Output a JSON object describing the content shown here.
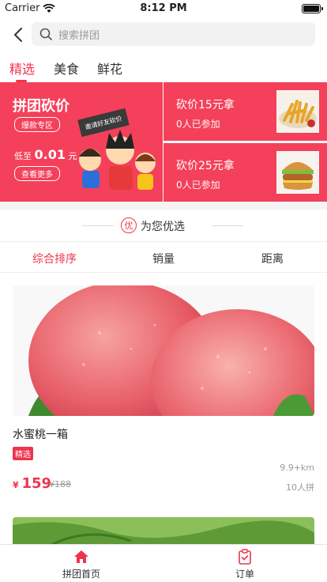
{
  "status_bar": {
    "carrier": "Carrier",
    "time": "8:12 PM"
  },
  "search": {
    "placeholder": "搜索拼团"
  },
  "tabs": [
    {
      "label": "精选",
      "active": true
    },
    {
      "label": "美食",
      "active": false
    },
    {
      "label": "鲜花",
      "active": false
    }
  ],
  "banner": {
    "left": {
      "title": "拼团砍价",
      "hot_label": "爆款专区",
      "price_prefix": "低至",
      "price_value": "0.01",
      "price_unit": "元",
      "more_label": "查看更多",
      "sign_text": "邀请好友砍价"
    },
    "right": [
      {
        "title": "砍价15元拿",
        "participants": "0人已参加",
        "image": "french-fries"
      },
      {
        "title": "砍价25元拿",
        "participants": "0人已参加",
        "image": "burger"
      }
    ]
  },
  "section": {
    "title": "为您优选",
    "badge": "优"
  },
  "sort": [
    {
      "label": "综合排序",
      "active": true
    },
    {
      "label": "销量",
      "active": false
    },
    {
      "label": "距离",
      "active": false
    }
  ],
  "products": [
    {
      "name": "水蜜桃一箱",
      "tag": "精选",
      "currency": "¥",
      "price": "159",
      "original_price": "¥188",
      "distance": "9.9+km",
      "joined": "10人拼",
      "image": "peaches"
    }
  ],
  "tabbar": [
    {
      "label": "拼团首页",
      "icon": "home-icon",
      "active": true
    },
    {
      "label": "订单",
      "icon": "order-icon",
      "active": false
    }
  ],
  "colors": {
    "accent": "#f0334d",
    "banner": "#f4405a"
  }
}
